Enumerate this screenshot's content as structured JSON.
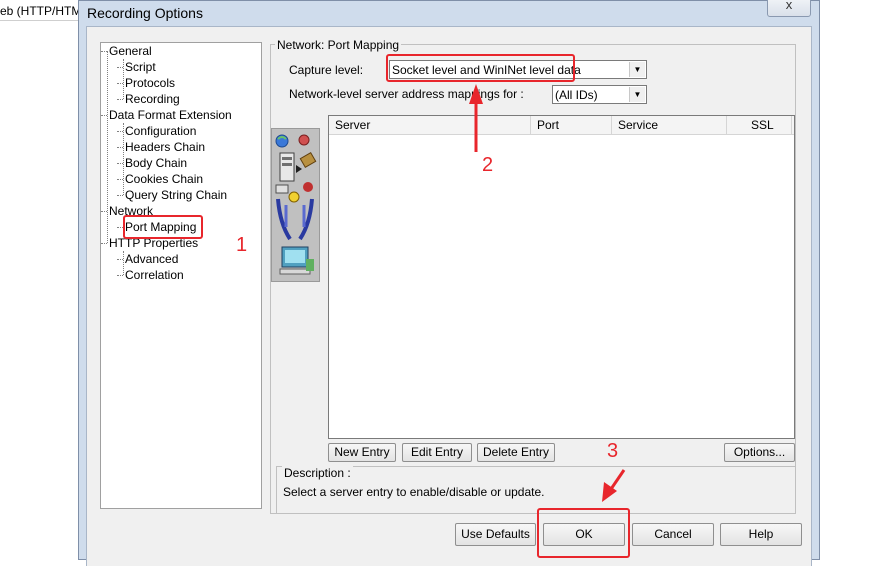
{
  "background_tab": {
    "text": "eb (HTTP/HTM"
  },
  "dialog": {
    "title": "Recording Options",
    "close_label": "x"
  },
  "tree": {
    "general": "General",
    "script": "Script",
    "protocols": "Protocols",
    "recording": "Recording",
    "data_format_extension": "Data Format Extension",
    "configuration": "Configuration",
    "headers_chain": "Headers Chain",
    "body_chain": "Body Chain",
    "cookies_chain": "Cookies Chain",
    "query_string_chain": "Query String Chain",
    "network": "Network",
    "port_mapping": "Port Mapping",
    "http_properties": "HTTP Properties",
    "advanced": "Advanced",
    "correlation": "Correlation"
  },
  "panel": {
    "title": "Network: Port Mapping",
    "capture_level_label": "Capture level:",
    "capture_level_value": "Socket level and WinINet level data",
    "mapping_label": "Network-level server address mappings for :",
    "mapping_value": "(All IDs)"
  },
  "table": {
    "columns": [
      "Server",
      "Port",
      "Service",
      "SSL"
    ],
    "rows": []
  },
  "buttons": {
    "new_entry": "New Entry",
    "edit_entry": "Edit Entry",
    "delete_entry": "Delete Entry",
    "options": "Options..."
  },
  "description": {
    "title": "Description :",
    "text": "Select a server entry to enable/disable or update."
  },
  "footer": {
    "use_defaults": "Use Defaults",
    "ok": "OK",
    "cancel": "Cancel",
    "help": "Help"
  },
  "annotations": {
    "n1": "1",
    "n2": "2",
    "n3": "3",
    "color": "#e8262c"
  }
}
